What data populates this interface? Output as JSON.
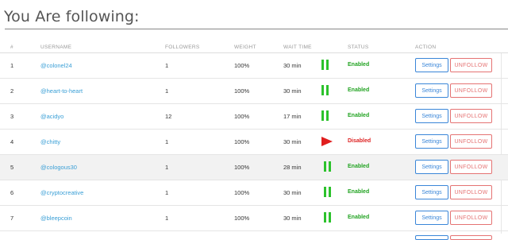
{
  "page": {
    "title": "You Are following:"
  },
  "table": {
    "headers": {
      "num": "#",
      "username": "USERNAME",
      "followers": "FOLLOWERS",
      "weight": "WEIGHT",
      "wait_time": "WAIT TIME",
      "status": "STATUS",
      "action": "ACTION"
    },
    "rows": [
      {
        "num": "1",
        "username": "@colonel24",
        "followers": "1",
        "weight": "100%",
        "wait": "30 min",
        "state_icon": "pause-icon",
        "status": "Enabled",
        "settings": "Settings",
        "unfollow": "UNFOLLOW"
      },
      {
        "num": "2",
        "username": "@heart-to-heart",
        "followers": "1",
        "weight": "100%",
        "wait": "30 min",
        "state_icon": "pause-icon",
        "status": "Enabled",
        "settings": "Settings",
        "unfollow": "UNFOLLOW"
      },
      {
        "num": "3",
        "username": "@acidyo",
        "followers": "12",
        "weight": "100%",
        "wait": "17 min",
        "state_icon": "pause-icon",
        "status": "Enabled",
        "settings": "Settings",
        "unfollow": "UNFOLLOW"
      },
      {
        "num": "4",
        "username": "@chitty",
        "followers": "1",
        "weight": "100%",
        "wait": "30 min",
        "state_icon": "play-icon",
        "status": "Disabled",
        "settings": "Settings",
        "unfollow": "UNFOLLOW"
      },
      {
        "num": "5",
        "username": "@cologous30",
        "followers": "1",
        "weight": "100%",
        "wait": "28 min",
        "state_icon": "pause-icon",
        "status": "Enabled",
        "settings": "Settings",
        "unfollow": "UNFOLLOW"
      },
      {
        "num": "6",
        "username": "@cryptocreative",
        "followers": "1",
        "weight": "100%",
        "wait": "30 min",
        "state_icon": "pause-icon",
        "status": "Enabled",
        "settings": "Settings",
        "unfollow": "UNFOLLOW"
      },
      {
        "num": "7",
        "username": "@bleepcoin",
        "followers": "1",
        "weight": "100%",
        "wait": "30 min",
        "state_icon": "pause-icon",
        "status": "Enabled",
        "settings": "Settings",
        "unfollow": "UNFOLLOW"
      }
    ],
    "highlighted_row": 5
  },
  "colors": {
    "link": "#3a9fd6",
    "enabled": "#22a322",
    "disabled": "#dd2222",
    "pause_icon": "#2cc22c",
    "play_icon": "#e01e1e",
    "settings_border": "#3a86d8",
    "unfollow_border": "#e57373"
  }
}
